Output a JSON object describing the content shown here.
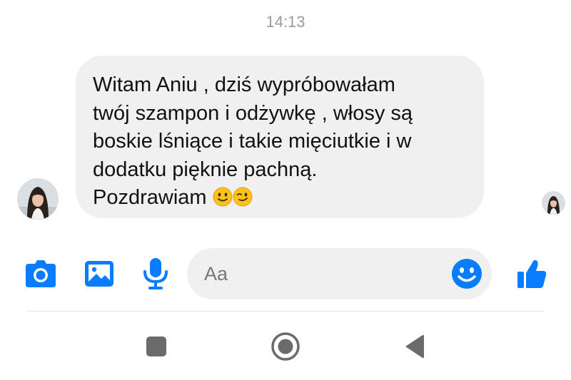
{
  "conversation": {
    "timestamp": "14:13",
    "message": {
      "lines": [
        "Witam Aniu , dziś wypróbowałam",
        "twój szampon i odżywkę , włosy są",
        "boskie lśniące i takie mięciutkie i w",
        "dodatku pięknie pachną.",
        "Pozdrawiam"
      ],
      "trailing_emojis": [
        "slightly-smiling-face",
        "winking-face"
      ],
      "bubble_color": "#f0f0f0"
    }
  },
  "composer": {
    "placeholder": "Aa",
    "icons": [
      "camera-icon",
      "gallery-icon",
      "microphone-icon",
      "emoji-icon",
      "thumbs-up-icon"
    ],
    "accent_color": "#0a7cff"
  },
  "system_nav": {
    "buttons": [
      "recents-button",
      "home-button",
      "back-button"
    ],
    "color": "#6b6b6b"
  }
}
